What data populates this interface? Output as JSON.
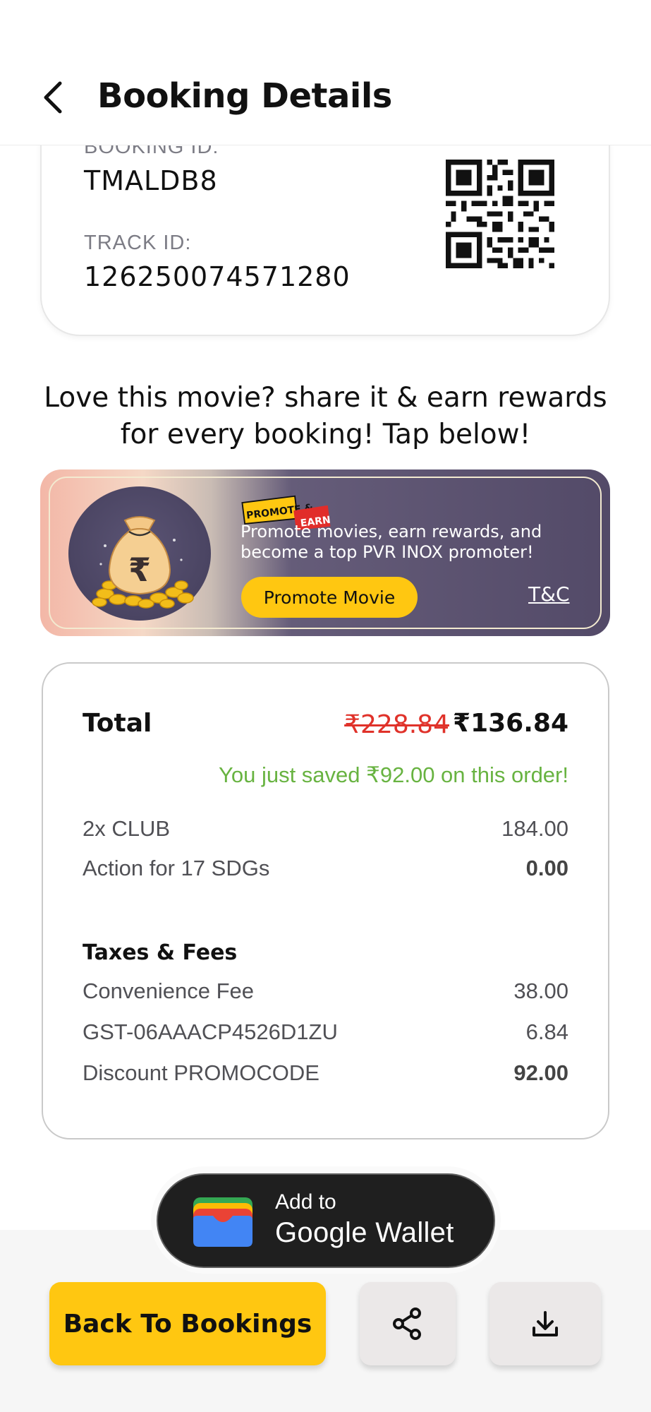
{
  "header": {
    "title": "Booking Details",
    "back_icon": "chevron-left-icon"
  },
  "booking": {
    "booking_id_label": "BOOKING ID:",
    "booking_id": "TMALDB8",
    "track_id_label": "TRACK ID:",
    "track_id": "126250074571280",
    "qr_icon": "qr-code"
  },
  "share_prompt": "Love this movie? share it & earn rewards for every booking! Tap below!",
  "banner": {
    "badge_promote": "PROMOTE &",
    "badge_earn": "EARN",
    "text": "Promote movies, earn rewards, and become a top PVR INOX promoter!",
    "button_label": "Promote Movie",
    "tc_label": "T&C",
    "coin_symbol": "₹",
    "colors": {
      "button": "#ffc711",
      "panel": "#534a68"
    }
  },
  "summary": {
    "total_label": "Total",
    "original_price": "₹228.84",
    "final_price": "₹136.84",
    "savings_text": "You just saved ₹92.00 on this order!",
    "items": [
      {
        "label": "2x CLUB",
        "value": "184.00"
      },
      {
        "label": "Action for 17 SDGs",
        "value": "0.00"
      }
    ],
    "taxes_title": "Taxes & Fees",
    "fees": [
      {
        "label": "Convenience Fee",
        "value": "38.00"
      },
      {
        "label": "GST-06AAACP4526D1ZU",
        "value": "6.84"
      },
      {
        "label": "Discount PROMOCODE",
        "value": "92.00"
      }
    ],
    "colors": {
      "strike": "#e0322a",
      "saved": "#68b341"
    }
  },
  "wallet": {
    "line1": "Add to",
    "line2": "Google Wallet",
    "icon": "google-wallet-icon"
  },
  "actions": {
    "back_to_bookings": "Back To Bookings",
    "share_icon": "share-icon",
    "download_icon": "download-icon",
    "accent": "#ffc711"
  }
}
